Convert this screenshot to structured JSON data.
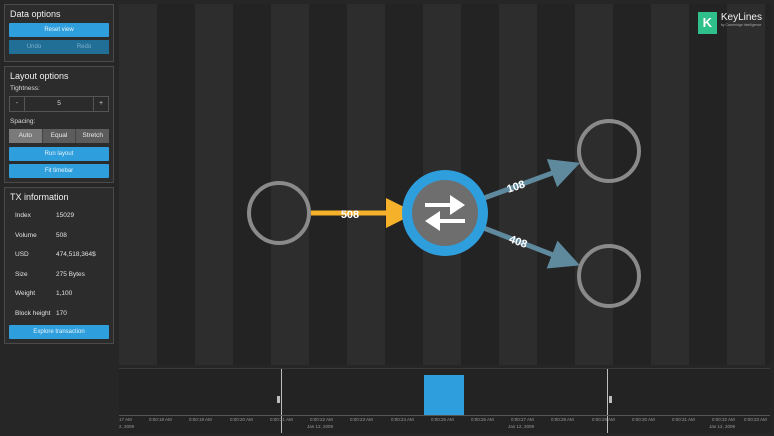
{
  "data_options": {
    "title": "Data options",
    "reset_view": "Reset view",
    "undo": "Undo",
    "redo": "Redo"
  },
  "layout_options": {
    "title": "Layout options",
    "tightness_label": "Tightness:",
    "tightness_minus": "-",
    "tightness_value": "5",
    "tightness_plus": "+",
    "spacing_label": "Spacing:",
    "spacing": [
      "Auto",
      "Equal",
      "Stretch"
    ],
    "run_layout": "Run layout",
    "fit_timebar": "Fit timebar"
  },
  "tx_information": {
    "title": "TX information",
    "rows": [
      {
        "key": "Index",
        "value": "15029"
      },
      {
        "key": "Volume",
        "value": "508"
      },
      {
        "key": "USD",
        "value": "474,518,364$"
      },
      {
        "key": "Size",
        "value": "275 Bytes"
      },
      {
        "key": "Weight",
        "value": "1,100"
      },
      {
        "key": "Block height",
        "value": "170"
      }
    ],
    "explore": "Explore transaction"
  },
  "brand": {
    "logo_mark": "K",
    "name": "KeyLines",
    "sub": "by Cambridge Intelligence"
  },
  "graph": {
    "links": [
      {
        "label": "508",
        "color": "#f5b12a"
      },
      {
        "label": "108",
        "color": "#5f8a9e"
      },
      {
        "label": "408",
        "color": "#5f8a9e"
      }
    ],
    "node_ring_color": "#8a8a8a",
    "hub_fill": "#2f9edc",
    "hub_inner": "#6e6e6e"
  },
  "timebar": {
    "bar_color": "#2f9edc",
    "tick_labels": [
      "17 AM",
      "0:00:18 AM",
      "0:00:19 AM",
      "0:00:20 AM",
      "0:00:21 AM",
      "0:00:22 AM",
      "0:00:23 AM",
      "0:00:24 AM",
      "0:00:25 AM",
      "0:00:26 AM",
      "0:00:27 AM",
      "0:00:28 AM",
      "0:00:29 AM",
      "0:00:30 AM",
      "0:00:31 AM",
      "0:00:32 AM",
      "0:00:33 AM"
    ],
    "date_labels": [
      "2, 2009",
      "Jan 12, 2009",
      "Jan 12, 2009",
      "Jan 12, 2009"
    ]
  }
}
